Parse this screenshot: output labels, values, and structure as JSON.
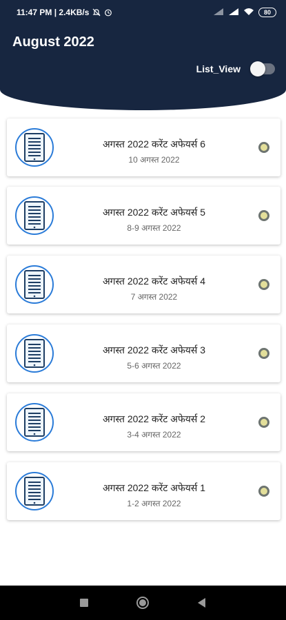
{
  "status_bar": {
    "time": "11:47 PM | 2.4KB/s",
    "battery": "80",
    "icons": [
      "mute-icon",
      "alarm-icon",
      "signal-icon",
      "signal-icon",
      "wifi-icon",
      "battery-icon"
    ]
  },
  "header": {
    "title": "August 2022",
    "list_view_label": "List_View",
    "list_view_on": false,
    "bg_color": "#172640"
  },
  "items": [
    {
      "title": "अगस्त 2022 करेंट अफेयर्स 6",
      "date": "10 अगस्त 2022"
    },
    {
      "title": "अगस्त 2022 करेंट अफेयर्स 5",
      "date": "8-9 अगस्त 2022"
    },
    {
      "title": "अगस्त 2022 करेंट अफेयर्स 4",
      "date": "7 अगस्त 2022"
    },
    {
      "title": "अगस्त 2022 करेंट अफेयर्स 3",
      "date": "5-6 अगस्त 2022"
    },
    {
      "title": "अगस्त 2022 करेंट अफेयर्स 2",
      "date": "3-4 अगस्त 2022"
    },
    {
      "title": "अगस्त 2022 करेंट अफेयर्स 1",
      "date": "1-2 अगस्त 2022"
    }
  ],
  "nav_bar": {
    "icons": [
      "recents-icon",
      "home-icon",
      "back-icon"
    ]
  }
}
